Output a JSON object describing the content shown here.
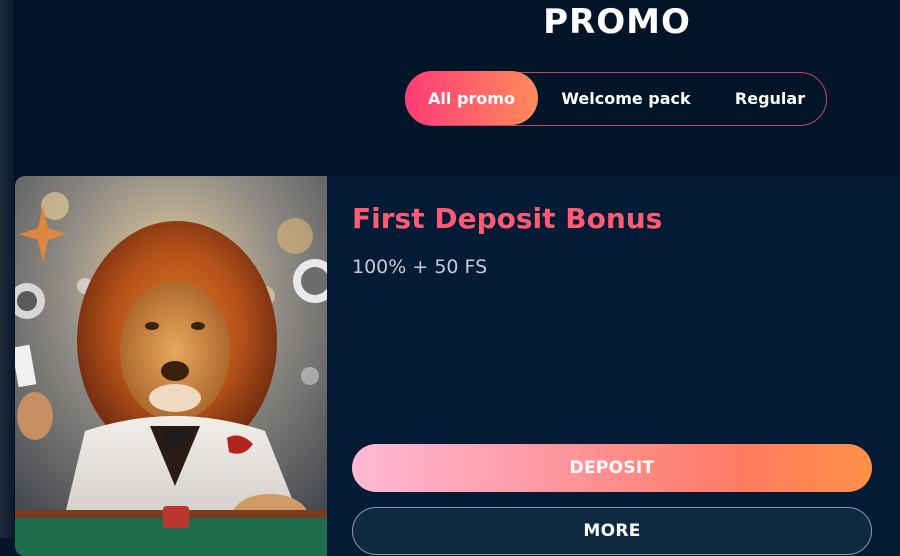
{
  "page": {
    "title": "PROMO"
  },
  "tabs": [
    {
      "label": "All promo",
      "active": true
    },
    {
      "label": "Welcome pack",
      "active": false
    },
    {
      "label": "Regular",
      "active": false
    }
  ],
  "promo_card": {
    "image_alt": "Lion in white suit at casino table",
    "title": "First Deposit Bonus",
    "subtitle": "100% + 50 FS",
    "deposit_label": "DEPOSIT",
    "more_label": "MORE"
  },
  "colors": {
    "background": "#021428",
    "card": "#031b35",
    "accent_pink": "#ff3b78",
    "accent_orange": "#ff8a5a",
    "title_red": "#ff5a73"
  }
}
